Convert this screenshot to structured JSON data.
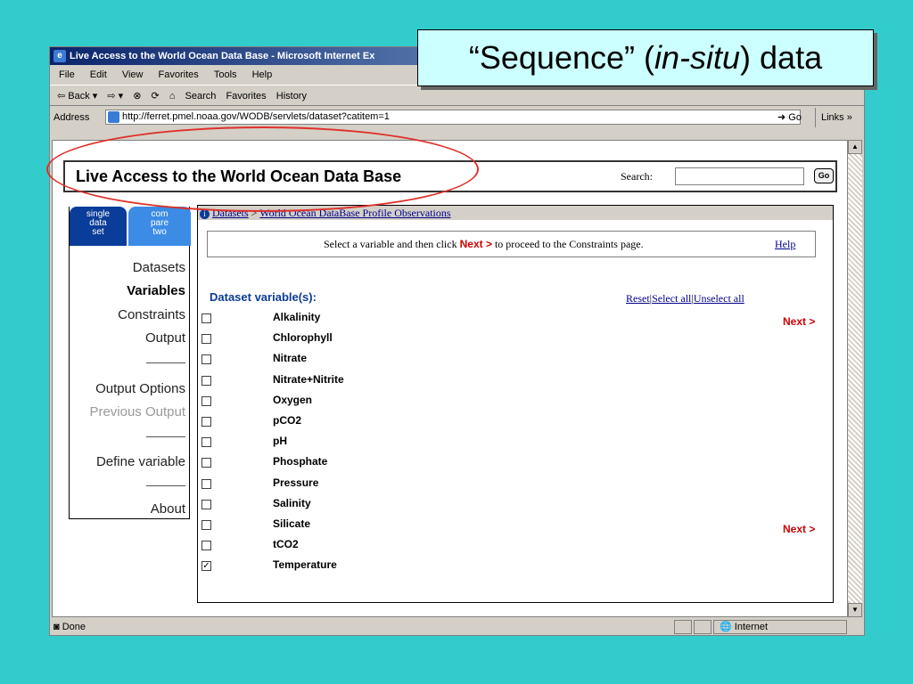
{
  "window": {
    "title": "Live Access to the World Ocean Data Base - Microsoft Internet Ex",
    "menu": [
      "File",
      "Edit",
      "View",
      "Favorites",
      "Tools",
      "Help"
    ],
    "toolbar": [
      "⇦ Back ▾",
      "⇨ ▾",
      "⊗",
      "⟳",
      "⌂",
      "Search",
      "Favorites",
      "History"
    ],
    "address_label": "Address",
    "address_value": "http://ferret.pmel.noaa.gov/WODB/servlets/dataset?catitem=1",
    "go_label": "Go",
    "links_label": "Links »",
    "status_text": "Done",
    "zone_text": "Internet"
  },
  "callout": {
    "before": "“Sequence” (",
    "italic": "in-situ",
    "after": ") data"
  },
  "banner": {
    "title": "Live Access to the World Ocean Data Base",
    "search_label": "Search:",
    "go_label": "Go"
  },
  "tabs": [
    {
      "label_lines": [
        "single",
        "data",
        "set"
      ]
    },
    {
      "label_lines": [
        "com",
        "pare",
        "two"
      ]
    }
  ],
  "nav": {
    "datasets": "Datasets",
    "variables": "Variables",
    "constraints": "Constraints",
    "output": "Output",
    "output_options": "Output Options",
    "previous_output": "Previous Output",
    "define_variable": "Define variable",
    "about": "About"
  },
  "breadcrumb": {
    "datasets": "Datasets",
    "sep": ">",
    "current": "World Ocean DataBase Profile Observations"
  },
  "instructions": {
    "before": "Select a variable and then click ",
    "next": "Next >",
    "after": " to proceed to the Constraints page.",
    "help": "Help"
  },
  "variables_header": "Dataset variable(s):",
  "actions": {
    "reset": "Reset",
    "select_all": "Select all",
    "unselect_all": "Unselect all",
    "sep": "|"
  },
  "next_label": "Next >",
  "variables": [
    {
      "name": "Alkalinity",
      "checked": false
    },
    {
      "name": "Chlorophyll",
      "checked": false
    },
    {
      "name": "Nitrate",
      "checked": false
    },
    {
      "name": "Nitrate+Nitrite",
      "checked": false
    },
    {
      "name": "Oxygen",
      "checked": false
    },
    {
      "name": "pCO2",
      "checked": false
    },
    {
      "name": "pH",
      "checked": false
    },
    {
      "name": "Phosphate",
      "checked": false
    },
    {
      "name": "Pressure",
      "checked": false
    },
    {
      "name": "Salinity",
      "checked": false
    },
    {
      "name": "Silicate",
      "checked": false
    },
    {
      "name": "tCO2",
      "checked": false
    },
    {
      "name": "Temperature",
      "checked": true
    }
  ]
}
